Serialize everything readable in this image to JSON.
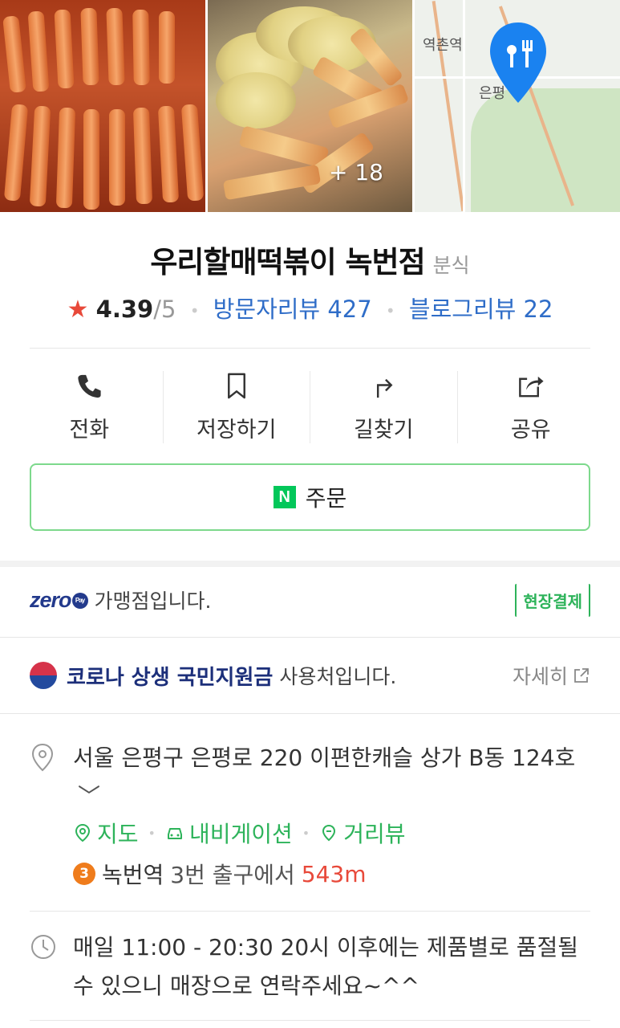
{
  "photos": {
    "more_count": "+ 18",
    "map_labels": [
      "역촌역",
      "은평"
    ]
  },
  "shop": {
    "name": "우리할매떡볶이 녹번점",
    "category": "분식",
    "rating": "4.39",
    "rating_max": "/5",
    "visitor_reviews": "방문자리뷰 427",
    "blog_reviews": "블로그리뷰 22"
  },
  "actions": [
    {
      "label": "전화",
      "icon": "phone-icon"
    },
    {
      "label": "저장하기",
      "icon": "bookmark-icon"
    },
    {
      "label": "길찾기",
      "icon": "directions-icon"
    },
    {
      "label": "공유",
      "icon": "share-icon"
    }
  ],
  "order": {
    "badge": "N",
    "label": "주문"
  },
  "zeropay": {
    "logo": "zero",
    "logo_pay": "Pay",
    "text": "가맹점입니다.",
    "onsite_badge": "현장결제"
  },
  "corona": {
    "bold": "코로나 상생 국민지원금",
    "text": "사용처입니다.",
    "detail": "자세히"
  },
  "address": {
    "text": "서울 은평구 은평로 220 이편한캐슬 상가 B동 124호",
    "links": [
      "지도",
      "내비게이션",
      "거리뷰"
    ],
    "subway_line": "3",
    "station": "녹번역",
    "exit": "3번 출구에서",
    "distance": "543m"
  },
  "hours": {
    "text": "매일 11:00 - 20:30 20시 이후에는 제품별로 품절될 수 있으니 매장으로 연락주세요~^^"
  },
  "colors": {
    "accent_green": "#2db35a",
    "link_blue": "#2f6dc8",
    "star_red": "#e8493a",
    "pin_blue": "#1a82f0"
  }
}
